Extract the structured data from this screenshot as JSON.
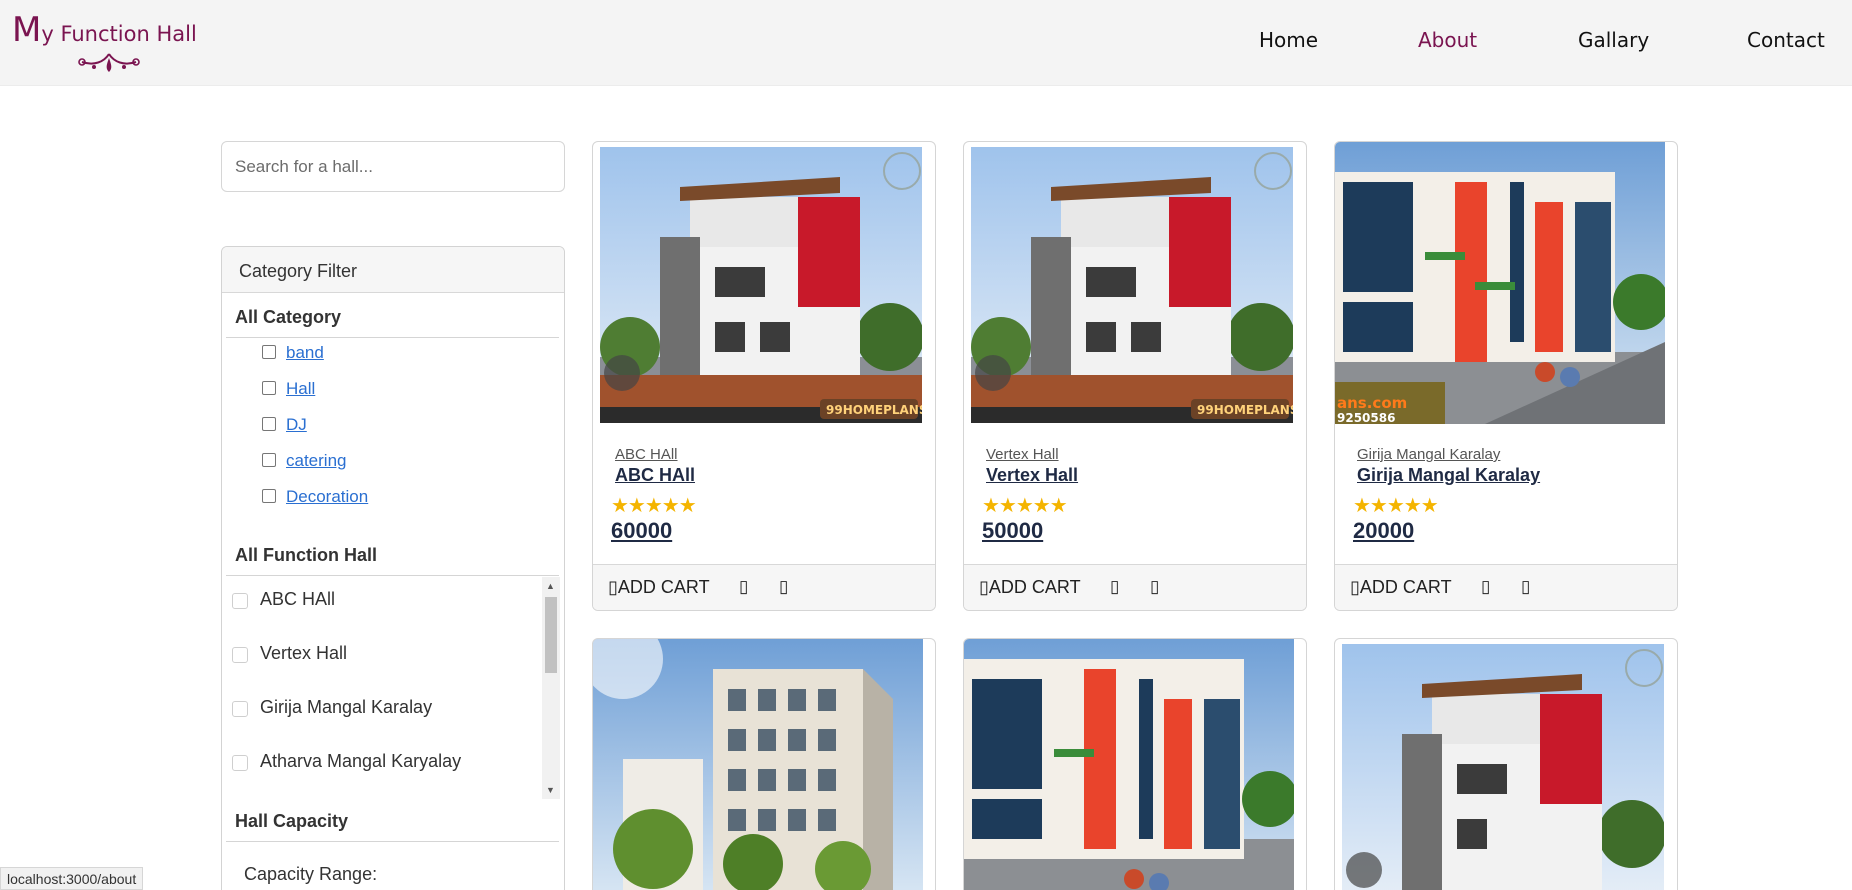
{
  "header": {
    "logo": {
      "big": "M",
      "rest": "y Function Hall"
    },
    "nav": [
      {
        "label": "Home"
      },
      {
        "label": "About"
      },
      {
        "label": "Gallary"
      },
      {
        "label": "Contact"
      }
    ],
    "active_nav": "About",
    "accent_color": "#7a1450"
  },
  "sidebar": {
    "search_placeholder": "Search for a hall...",
    "filter_title": "Category Filter",
    "category_title": "All Category",
    "categories": [
      "band",
      "Hall",
      "DJ",
      "catering",
      "Decoration"
    ],
    "function_hall_title": "All Function Hall",
    "halls": [
      "ABC HAll",
      "Vertex Hall",
      "Girija Mangal Karalay",
      "Atharva Mangal Karyalay"
    ],
    "capacity_title": "Hall Capacity",
    "capacity_label": "Capacity Range:"
  },
  "cards": [
    {
      "subtitle": "ABC HAll",
      "title": "ABC HAll",
      "stars": "★★★★★",
      "price": "60000",
      "cart_label": "ADD CART"
    },
    {
      "subtitle": "Vertex Hall",
      "title": "Vertex Hall",
      "stars": "★★★★★",
      "price": "50000",
      "cart_label": "ADD CART"
    },
    {
      "subtitle": "Girija Mangal Karalay",
      "title": "Girija Mangal Karalay",
      "stars": "★★★★★",
      "price": "20000",
      "cart_label": "ADD CART"
    },
    {
      "subtitle": "",
      "title": "",
      "stars": "",
      "price": "",
      "cart_label": ""
    },
    {
      "subtitle": "",
      "title": "",
      "stars": "",
      "price": "",
      "cart_label": ""
    },
    {
      "subtitle": "",
      "title": "",
      "stars": "",
      "price": "",
      "cart_label": ""
    }
  ],
  "image_overlay_text": {
    "brand": "99HOMEPLANS",
    "site": "ans.com",
    "phone": "9250586"
  },
  "status_bar": "localhost:3000/about",
  "colors": {
    "star": "#f4b400",
    "link": "#2a6fd1"
  }
}
